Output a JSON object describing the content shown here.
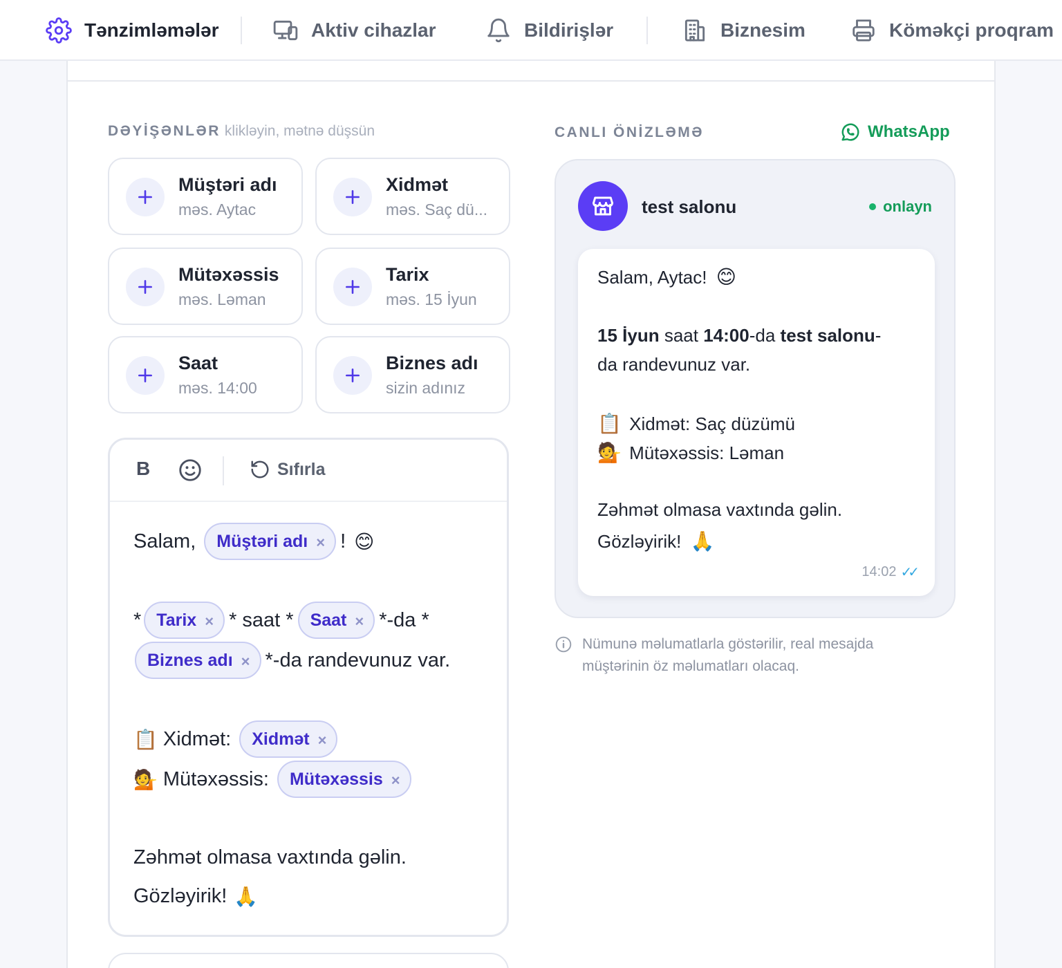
{
  "nav": {
    "items": [
      {
        "label": "Tənzimləmələr",
        "icon": "gear-icon",
        "active": true
      },
      {
        "label": "Aktiv cihazlar",
        "icon": "devices-icon",
        "active": false
      },
      {
        "label": "Bildirişlər",
        "icon": "bell-icon",
        "active": false
      },
      {
        "label": "Biznesim",
        "icon": "building-icon",
        "active": false
      },
      {
        "label": "Köməkçi proqram",
        "icon": "printer-icon",
        "active": false
      }
    ]
  },
  "variables": {
    "title": "DƏYİŞƏNLƏR",
    "hint": "klikləyin, mətnə düşsün",
    "items": [
      {
        "label": "Müştəri adı",
        "example": "məs. Aytac"
      },
      {
        "label": "Xidmət",
        "example": "məs. Saç dü..."
      },
      {
        "label": "Mütəxəssis",
        "example": "məs. Ləman"
      },
      {
        "label": "Tarix",
        "example": "məs. 15 İyun"
      },
      {
        "label": "Saat",
        "example": "məs. 14:00"
      },
      {
        "label": "Biznes adı",
        "example": "sizin adınız"
      }
    ]
  },
  "editor": {
    "toolbar": {
      "bold": "B",
      "reset": "Sıfırla"
    },
    "line1": {
      "prefix": "Salam,",
      "chip": "Müştəri adı",
      "suffix": "!",
      "emoji": "😊"
    },
    "line2": {
      "star_open": "*",
      "chip_date": "Tarix",
      "mid1": "* saat *",
      "chip_time": "Saat",
      "mid2": "*-da *"
    },
    "line3": {
      "chip_business": "Biznes adı",
      "suffix": "*-da randevunuz var."
    },
    "line4": {
      "emoji": "📋",
      "label": "Xidmət:",
      "chip": "Xidmət"
    },
    "line5": {
      "emoji": "💁",
      "label": "Mütəxəssis:",
      "chip": "Mütəxəssis"
    },
    "line6": "Zəhmət olmasa vaxtında gəlin.",
    "line7": {
      "text": "Gözləyirik!",
      "emoji": "🙏"
    },
    "chip_remove": "×"
  },
  "preview": {
    "title": "CANLI ÖNİZLƏMƏ",
    "channel": "WhatsApp",
    "salon_name": "test salonu",
    "status": "onlayn",
    "message": {
      "greeting": "Salam, Aytac!",
      "greeting_emoji": "😊",
      "date": "15 İyun",
      "saat": "saat",
      "time": "14:00",
      "da": "-da",
      "business": "test salonu",
      "dash": "-",
      "line_cont": "da randevunuz var.",
      "service_emoji": "📋",
      "service": "Xidmət: Saç düzümü",
      "specialist_emoji": "💁",
      "specialist": "Mütəxəssis: Ləman",
      "please": "Zəhmət olmasa vaxtında gəlin.",
      "waiting": "Gözləyirik!",
      "waiting_emoji": "🙏",
      "time_sent": "14:02",
      "ticks": "✓✓"
    },
    "note": "Nümunə məlumatlarla göstərilir, real mesajda müştərinin öz məlumatları olacaq."
  },
  "colors": {
    "accent": "#5b3df5",
    "whatsapp": "#149c59",
    "chip_bg": "#eef0fb",
    "chip_text": "#3f2cc9"
  }
}
